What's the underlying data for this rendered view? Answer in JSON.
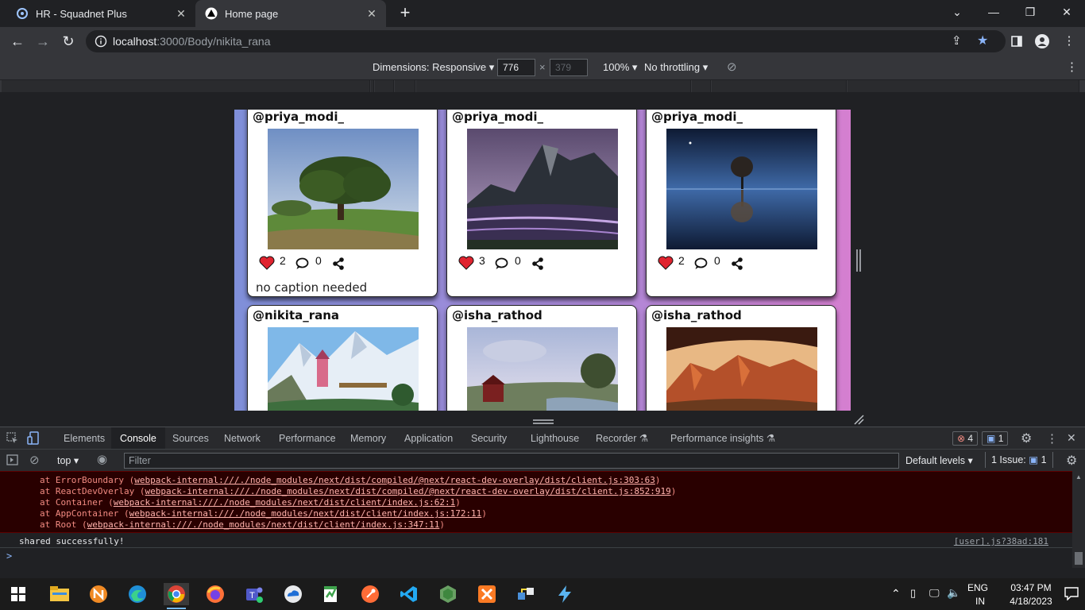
{
  "browser": {
    "tabs": [
      {
        "title": "HR - Squadnet Plus",
        "active": false
      },
      {
        "title": "Home page",
        "active": true
      }
    ],
    "url_host": "localhost",
    "url_path": ":3000/Body/nikita_rana"
  },
  "device_toolbar": {
    "dimensions_label": "Dimensions: Responsive",
    "width": "776",
    "height": "379",
    "zoom": "100%",
    "throttling": "No throttling",
    "separator": "×"
  },
  "posts": [
    {
      "user": "@priya_modi_",
      "likes": "2",
      "comments": "0",
      "caption": "no caption needed"
    },
    {
      "user": "@priya_modi_",
      "likes": "3",
      "comments": "0",
      "caption": ""
    },
    {
      "user": "@priya_modi_",
      "likes": "2",
      "comments": "0",
      "caption": ""
    },
    {
      "user": "@nikita_rana",
      "likes": "",
      "comments": "",
      "caption": ""
    },
    {
      "user": "@isha_rathod",
      "likes": "",
      "comments": "",
      "caption": ""
    },
    {
      "user": "@isha_rathod",
      "likes": "",
      "comments": "",
      "caption": ""
    }
  ],
  "devtools": {
    "tabs": [
      "Elements",
      "Console",
      "Sources",
      "Network",
      "Performance",
      "Memory",
      "Application",
      "Security",
      "Lighthouse",
      "Recorder",
      "Performance insights"
    ],
    "active_tab": "Console",
    "error_count": "4",
    "message_count": "1",
    "context": "top",
    "filter_placeholder": "Filter",
    "levels": "Default levels",
    "issues": "1 Issue:",
    "issues_count": "1",
    "stack": [
      {
        "fn": "at ErrorBoundary (",
        "link": "webpack-internal:///./node_modules/next/dist/compiled/@next/react-dev-overlay/dist/client.js:303:63",
        "end": ")"
      },
      {
        "fn": "at ReactDevOverlay (",
        "link": "webpack-internal:///./node_modules/next/dist/compiled/@next/react-dev-overlay/dist/client.js:852:919",
        "end": ")"
      },
      {
        "fn": "at Container (",
        "link": "webpack-internal:///./node_modules/next/dist/client/index.js:62:1",
        "end": ")"
      },
      {
        "fn": "at AppContainer (",
        "link": "webpack-internal:///./node_modules/next/dist/client/index.js:172:11",
        "end": ")"
      },
      {
        "fn": "at Root (",
        "link": "webpack-internal:///./node_modules/next/dist/client/index.js:347:11",
        "end": ")"
      }
    ],
    "log_message": "shared successfully!",
    "log_source": "[user].js?38ad:181",
    "prompt": ">"
  },
  "taskbar": {
    "lang": "ENG",
    "region": "IN",
    "time": "03:47 PM",
    "date": "4/18/2023"
  },
  "colors": {
    "heart": "#e0242f",
    "accent_blue": "#8ab4f8",
    "error_text": "#f28b82"
  }
}
